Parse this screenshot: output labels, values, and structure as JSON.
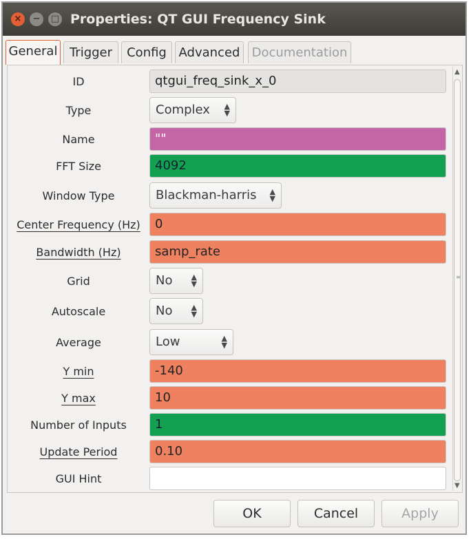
{
  "window": {
    "title": "Properties: QT GUI Frequency Sink",
    "close_glyph": "×",
    "min_glyph": "−",
    "max_glyph": "□"
  },
  "tabs": [
    {
      "label": "General",
      "active": true
    },
    {
      "label": "Trigger"
    },
    {
      "label": "Config"
    },
    {
      "label": "Advanced"
    },
    {
      "label": "Documentation",
      "disabled": true
    }
  ],
  "properties": {
    "id": {
      "label": "ID",
      "value": "qtgui_freq_sink_x_0"
    },
    "type": {
      "label": "Type",
      "value": "Complex"
    },
    "name": {
      "label": "Name",
      "value": "\"\""
    },
    "fft_size": {
      "label": "FFT Size",
      "value": "4092"
    },
    "window_type": {
      "label": "Window Type",
      "value": "Blackman-harris"
    },
    "center_freq": {
      "label": "Center Frequency (Hz)",
      "value": "0"
    },
    "bandwidth": {
      "label": "Bandwidth (Hz)",
      "value": "samp_rate"
    },
    "grid": {
      "label": "Grid",
      "value": "No"
    },
    "autoscale": {
      "label": "Autoscale",
      "value": "No"
    },
    "average": {
      "label": "Average",
      "value": "Low"
    },
    "ymin": {
      "label": "Y min",
      "value": "-140"
    },
    "ymax": {
      "label": "Y max",
      "value": "10"
    },
    "num_inputs": {
      "label": "Number of Inputs",
      "value": "1"
    },
    "update_period": {
      "label": "Update Period",
      "value": "0.10"
    },
    "gui_hint": {
      "label": "GUI Hint",
      "value": ""
    }
  },
  "buttons": {
    "ok": "OK",
    "cancel": "Cancel",
    "apply": "Apply"
  },
  "colors": {
    "pink": "#c465a6",
    "green": "#13a050",
    "orange": "#ed8160",
    "accent": "#e35f36"
  }
}
